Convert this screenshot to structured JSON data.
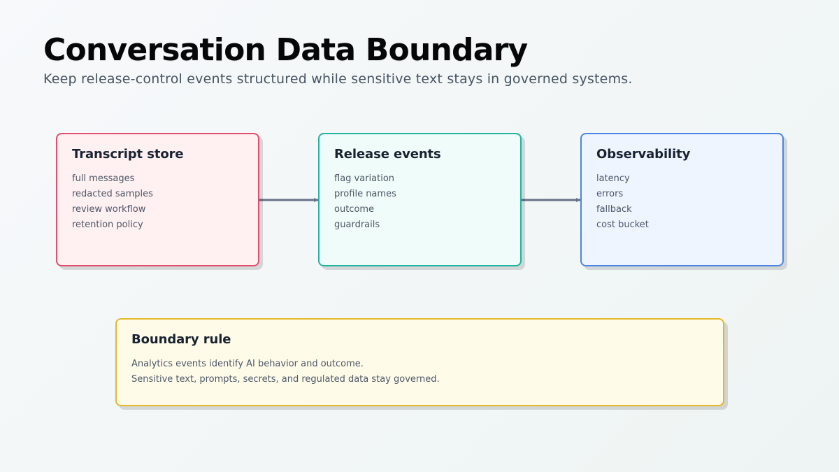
{
  "header": {
    "title": "Conversation Data Boundary",
    "subtitle": "Keep release-control events structured while sensitive text stays in governed systems."
  },
  "nodes": [
    {
      "title": "Transcript store",
      "items": [
        "full messages",
        "redacted samples",
        "review workflow",
        "retention policy"
      ],
      "border_color": "#e0506e",
      "fill_color": "#fff0f2"
    },
    {
      "title": "Release events",
      "items": [
        "flag variation",
        "profile names",
        "outcome",
        "guardrails"
      ],
      "border_color": "#22b4a0",
      "fill_color": "#effcf9"
    },
    {
      "title": "Observability",
      "items": [
        "latency",
        "errors",
        "fallback",
        "cost bucket"
      ],
      "border_color": "#4c86e2",
      "fill_color": "#eef5ff"
    }
  ],
  "edges": [
    {
      "from": "Transcript store",
      "to": "Release events"
    },
    {
      "from": "Release events",
      "to": "Observability"
    }
  ],
  "boundary_rule": {
    "title": "Boundary rule",
    "lines": [
      "Analytics events identify AI behavior and outcome.",
      "Sensitive text, prompts, secrets, and regulated data stay governed."
    ],
    "border_color": "#e5b82c",
    "fill_color": "#fffbe9"
  },
  "colors": {
    "arrow": "#667386",
    "title_text": "#060708",
    "subtitle_text": "#475462"
  }
}
